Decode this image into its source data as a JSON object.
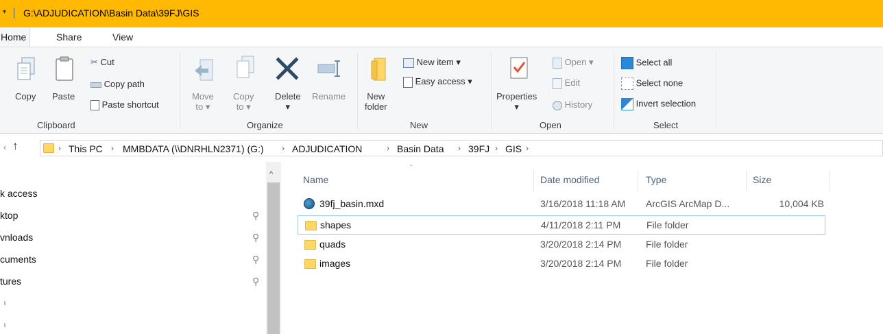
{
  "titlebar": {
    "path": "G:\\ADJUDICATION\\Basin Data\\39FJ\\GIS",
    "qa_arrow": "▾",
    "bg": "#ffb900"
  },
  "tabs": {
    "home": "Home",
    "share": "Share",
    "view": "View"
  },
  "ribbon": {
    "clipboard": {
      "group": "Clipboard",
      "copy": "Copy",
      "paste": "Paste",
      "cut": "Cut",
      "copy_path": "Copy path",
      "paste_shortcut": "Paste shortcut"
    },
    "organize": {
      "group": "Organize",
      "move_to_1": "Move",
      "move_to_2": "to ▾",
      "copy_to_1": "Copy",
      "copy_to_2": "to ▾",
      "delete": "Delete",
      "delete_arrow": "▾",
      "rename": "Rename"
    },
    "new": {
      "group": "New",
      "new_folder_1": "New",
      "new_folder_2": "folder",
      "new_item": "New item ▾",
      "easy_access": "Easy access ▾"
    },
    "open": {
      "group": "Open",
      "properties": "Properties",
      "properties_arrow": "▾",
      "open": "Open ▾",
      "edit": "Edit",
      "history": "History"
    },
    "select": {
      "group": "Select",
      "select_all": "Select all",
      "select_none": "Select none",
      "invert_selection": "Invert selection"
    }
  },
  "address": {
    "back": "‹",
    "up": "↑",
    "crumbs": [
      "This PC",
      "MMBDATA (\\\\DNRHLN2371) (G:)",
      "ADJUDICATION",
      "Basin Data",
      "39FJ",
      "GIS"
    ],
    "chevron": "›"
  },
  "nav": {
    "items": [
      "k access",
      "ktop",
      "vnloads",
      "cuments",
      "tures"
    ],
    "pin": "⚲",
    "scroll_up": "^"
  },
  "columns": {
    "name": "Name",
    "date": "Date modified",
    "type": "Type",
    "size": "Size",
    "sort_indicator": "ˇ"
  },
  "files": [
    {
      "name": "39fj_basin.mxd",
      "date": "3/16/2018 11:18 AM",
      "type": "ArcGIS ArcMap D...",
      "size": "10,004 KB",
      "icon": "arcmap-document-icon"
    },
    {
      "name": "shapes",
      "date": "4/11/2018 2:11 PM",
      "type": "File folder",
      "size": "",
      "icon": "folder-icon"
    },
    {
      "name": "quads",
      "date": "3/20/2018 2:14 PM",
      "type": "File folder",
      "size": "",
      "icon": "folder-icon"
    },
    {
      "name": "images",
      "date": "3/20/2018 2:14 PM",
      "type": "File folder",
      "size": "",
      "icon": "folder-icon"
    }
  ]
}
